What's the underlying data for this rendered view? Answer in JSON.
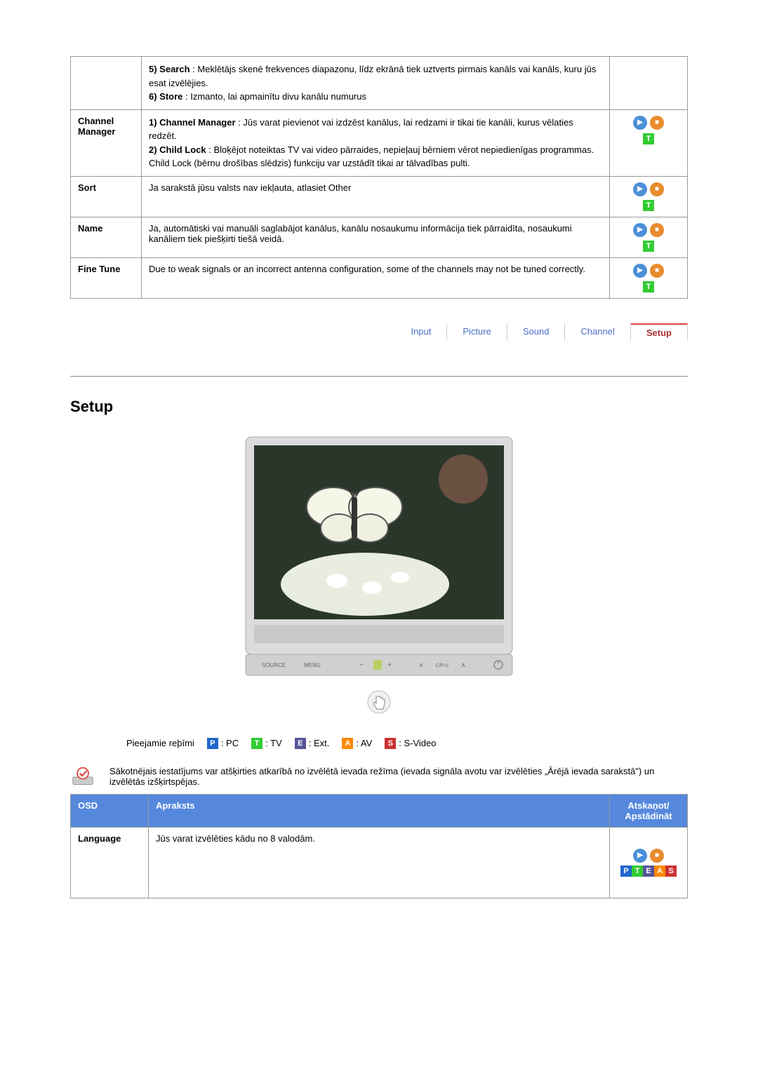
{
  "table1": {
    "rows": [
      {
        "label": "",
        "segments": [
          {
            "bold": "5) Search",
            "text": " : Meklētājs skenē frekvences diapazonu, līdz ekrānā tiek uztverts pirmais kanāls vai kanāls, kuru jūs esat izvēlējies."
          },
          {
            "bold": "6) Store",
            "text": " : Izmanto, lai apmainītu divu kanālu numurus"
          }
        ],
        "icons": false
      },
      {
        "label": "Channel Manager",
        "segments": [
          {
            "bold": "1) Channel Manager",
            "text": " : Jūs varat pievienot vai izdzēst kanālus, lai redzami ir tikai tie kanāli, kurus vēlaties redzēt."
          },
          {
            "bold": "2) Child Lock",
            "text": " : Bloķējot noteiktas TV vai video pārraides, nepieļauj bērniem vērot nepiedienīgas programmas. Child Lock (bērnu drošības slēdzis) funkciju var uzstādīt tikai ar tālvadības pulti."
          }
        ],
        "icons": true
      },
      {
        "label": "Sort",
        "segments": [
          {
            "bold": "",
            "text": "Ja sarakstā jūsu valsts nav iekļauta, atlasiet Other"
          }
        ],
        "icons": true
      },
      {
        "label": "Name",
        "segments": [
          {
            "bold": "",
            "text": "Ja, automātiski vai manuāli saglabājot kanālus, kanālu nosaukumu informācija tiek pārraidīta, nosaukumi kanāliem tiek piešķirti tiešā veidā."
          }
        ],
        "icons": true
      },
      {
        "label": "Fine Tune",
        "segments": [
          {
            "bold": "",
            "text": "Due to weak signals or an incorrect antenna configuration, some of the channels may not be tuned correctly."
          }
        ],
        "icons": true
      }
    ]
  },
  "tabs": [
    {
      "label": "Input",
      "active": false
    },
    {
      "label": "Picture",
      "active": false
    },
    {
      "label": "Sound",
      "active": false
    },
    {
      "label": "Channel",
      "active": false
    },
    {
      "label": "Setup",
      "active": true
    }
  ],
  "sectionTitle": "Setup",
  "monitor": {
    "buttons": [
      "SOURCE",
      "MENU",
      "−",
      "+",
      "∨",
      "C/P.⊙",
      "∧"
    ]
  },
  "modesLabel": "Pieejamie reþīmi",
  "modes": [
    {
      "letter": "P",
      "color": "sq-blue",
      "text": ": PC"
    },
    {
      "letter": "T",
      "color": "sq-green",
      "text": ": TV"
    },
    {
      "letter": "E",
      "color": "sq-dark",
      "text": ": Ext."
    },
    {
      "letter": "A",
      "color": "sq-orange",
      "text": ": AV"
    },
    {
      "letter": "S",
      "color": "sq-red",
      "text": ": S-Video"
    }
  ],
  "noteText": "Sākotnējais iestatījums var atšķirties atkarībā no izvēlētā ievada režīma (ievada signāla avotu var izvēlēties „Ārējā ievada sarakstā\") un izvēlētās izšķirtspējas.",
  "table2": {
    "headers": {
      "c1": "OSD",
      "c2": "Apraksts",
      "c3a": "Atskaņot/",
      "c3b": "Apstādināt"
    },
    "rows": [
      {
        "label": "Language",
        "text": "Jūs varat izvēlēties kādu no 8 valodām.",
        "pteas": [
          "P",
          "T",
          "E",
          "A",
          "S"
        ]
      }
    ]
  }
}
